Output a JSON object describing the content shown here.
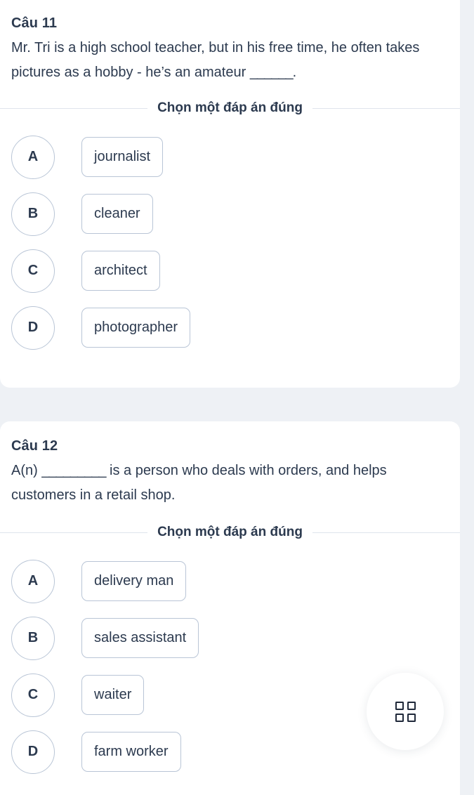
{
  "theme": {
    "page_background": "#eef1f5",
    "card_background": "#ffffff",
    "text_color": "#2c3a4f",
    "border_color": "#b9c5d6",
    "divider_color": "#dfe4ec"
  },
  "questions": [
    {
      "number": "Câu 11",
      "text_before": "Mr. Tri is a high school teacher, but in his free time, he often takes pictures as a hobby - he’s an amateur ",
      "blank": "______",
      "text_after": ".",
      "prompt": "Chọn một đáp án đúng",
      "options": [
        {
          "letter": "A",
          "label": "journalist"
        },
        {
          "letter": "B",
          "label": "cleaner"
        },
        {
          "letter": "C",
          "label": "architect"
        },
        {
          "letter": "D",
          "label": "photographer"
        }
      ]
    },
    {
      "number": "Câu 12",
      "text_before": "A(n) ",
      "blank": "_________",
      "text_after": " is a person who deals with orders, and helps customers in a retail shop.",
      "prompt": "Chọn một đáp án đúng",
      "options": [
        {
          "letter": "A",
          "label": "delivery man"
        },
        {
          "letter": "B",
          "label": "sales assistant"
        },
        {
          "letter": "C",
          "label": "waiter"
        },
        {
          "letter": "D",
          "label": "farm worker"
        }
      ]
    }
  ],
  "floating_button": {
    "icon": "grid-icon"
  }
}
